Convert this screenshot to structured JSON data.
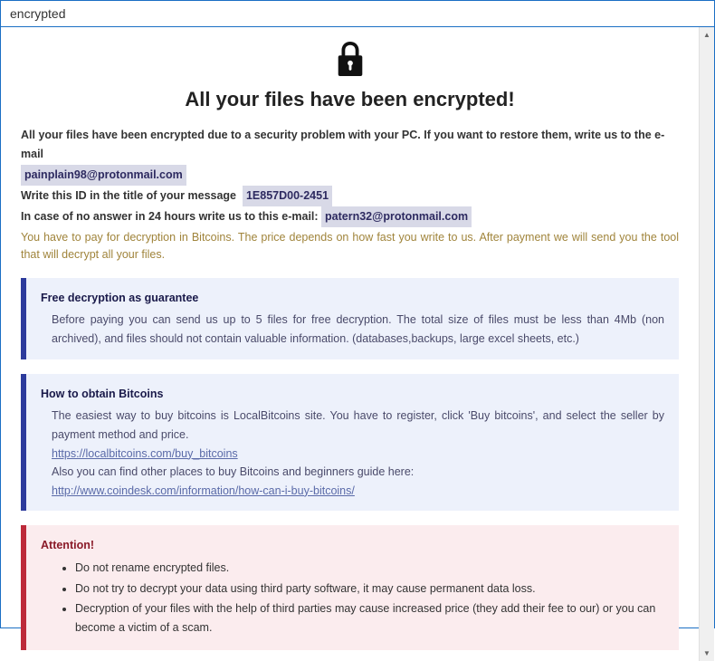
{
  "window": {
    "title": "encrypted"
  },
  "header": {
    "heading": "All your files have been encrypted!"
  },
  "intro": {
    "line1": "All your files have been encrypted due to a security problem with your PC. If you want to restore them, write us to the e-mail",
    "email1": "painplain98@protonmail.com",
    "line2a": "Write this ID in the title of your message",
    "id": "1E857D00-2451",
    "line3a": "In case of no answer in 24 hours write us to this e-mail:",
    "email2": "patern32@protonmail.com",
    "pay": "You have to pay for decryption in Bitcoins. The price depends on how fast you write to us. After payment we will send you the tool that will decrypt all your files."
  },
  "box1": {
    "title": "Free decryption as guarantee",
    "body": "Before paying you can send us up to 5 files for free decryption. The total size of files must be less than 4Mb (non archived), and files should not contain valuable information. (databases,backups, large excel sheets, etc.)"
  },
  "box2": {
    "title": "How to obtain Bitcoins",
    "p1": "The easiest way to buy bitcoins is LocalBitcoins site. You have to register, click 'Buy bitcoins', and select the seller by payment method and price.",
    "link1": "https://localbitcoins.com/buy_bitcoins",
    "p2": "Also you can find other places to buy Bitcoins and beginners guide here:",
    "link2": "http://www.coindesk.com/information/how-can-i-buy-bitcoins/"
  },
  "box3": {
    "title": "Attention!",
    "items": [
      "Do not rename encrypted files.",
      "Do not try to decrypt your data using third party software, it may cause permanent data loss.",
      "Decryption of your files with the help of third parties may cause increased price (they add their fee to our) or you can become a victim of a scam."
    ]
  }
}
